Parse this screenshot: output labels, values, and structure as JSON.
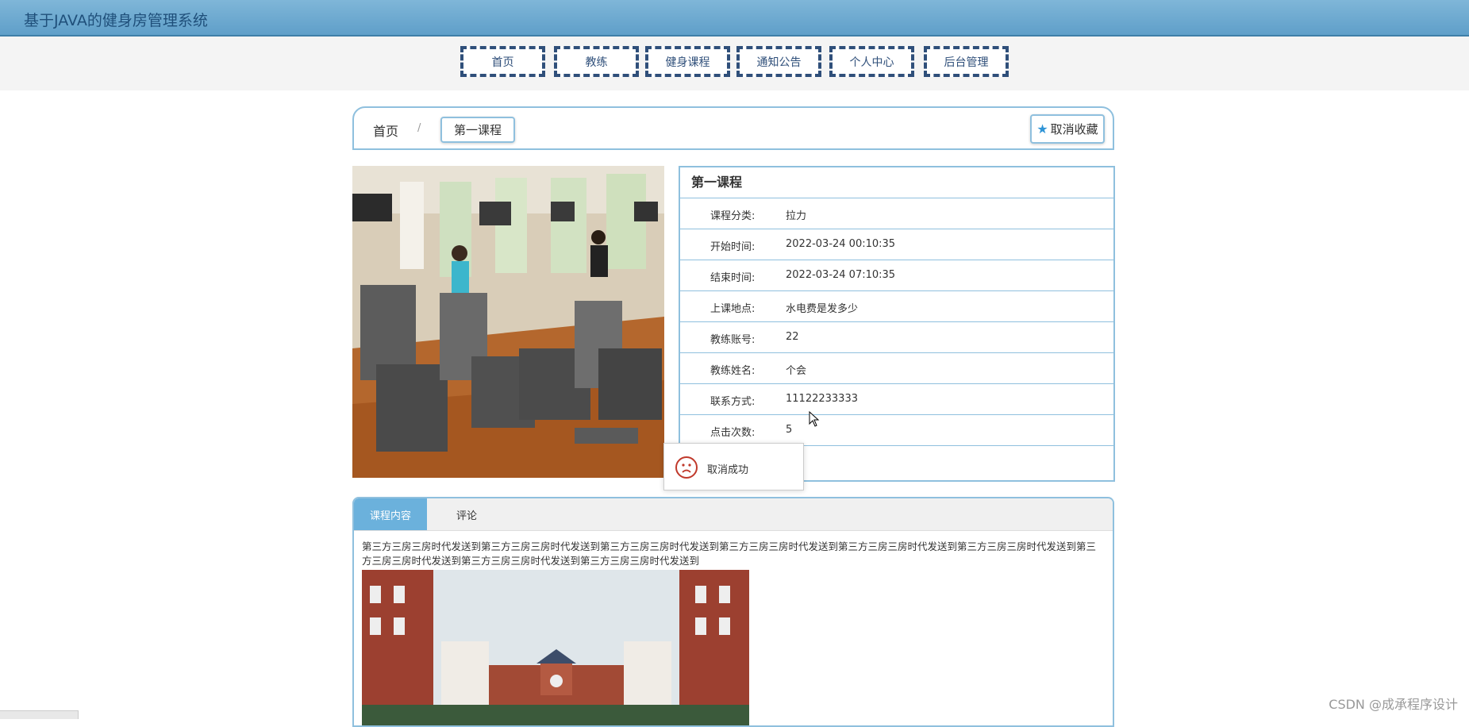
{
  "app": {
    "title": "基于JAVA的健身房管理系统"
  },
  "nav": [
    {
      "label": "首页"
    },
    {
      "label": "教练"
    },
    {
      "label": "健身课程"
    },
    {
      "label": "通知公告"
    },
    {
      "label": "个人中心"
    },
    {
      "label": "后台管理"
    }
  ],
  "breadcrumb": {
    "home": "首页",
    "separator": "/",
    "current": "第一课程"
  },
  "favorite_button": {
    "label": "取消收藏",
    "icon": "star-icon"
  },
  "course": {
    "title": "第一课程",
    "fields": [
      {
        "label": "课程分类:",
        "value": "拉力"
      },
      {
        "label": "开始时间:",
        "value": "2022-03-24 00:10:35"
      },
      {
        "label": "结束时间:",
        "value": "2022-03-24 07:10:35"
      },
      {
        "label": "上课地点:",
        "value": "水电费是发多少"
      },
      {
        "label": "教练账号:",
        "value": "22"
      },
      {
        "label": "教练姓名:",
        "value": "个会"
      },
      {
        "label": "联系方式:",
        "value": "11122233333"
      },
      {
        "label": "点击次数:",
        "value": "5"
      }
    ]
  },
  "toast": {
    "message": "取消成功",
    "icon": "sad-face-icon"
  },
  "tabs": [
    {
      "label": "课程内容"
    },
    {
      "label": "评论"
    }
  ],
  "content_text": "第三方三房三房时代发送到第三方三房三房时代发送到第三方三房三房时代发送到第三方三房三房时代发送到第三方三房三房时代发送到第三方三房三房时代发送到第三方三房三房时代发送到第三方三房三房时代发送到第三方三房三房时代发送到",
  "watermark": "CSDN @成承程序设计",
  "colors": {
    "header": "#6aa8d0",
    "nav_border": "#2f4f7a",
    "accent": "#8fc0de",
    "active_tab": "#6bb1dc"
  }
}
